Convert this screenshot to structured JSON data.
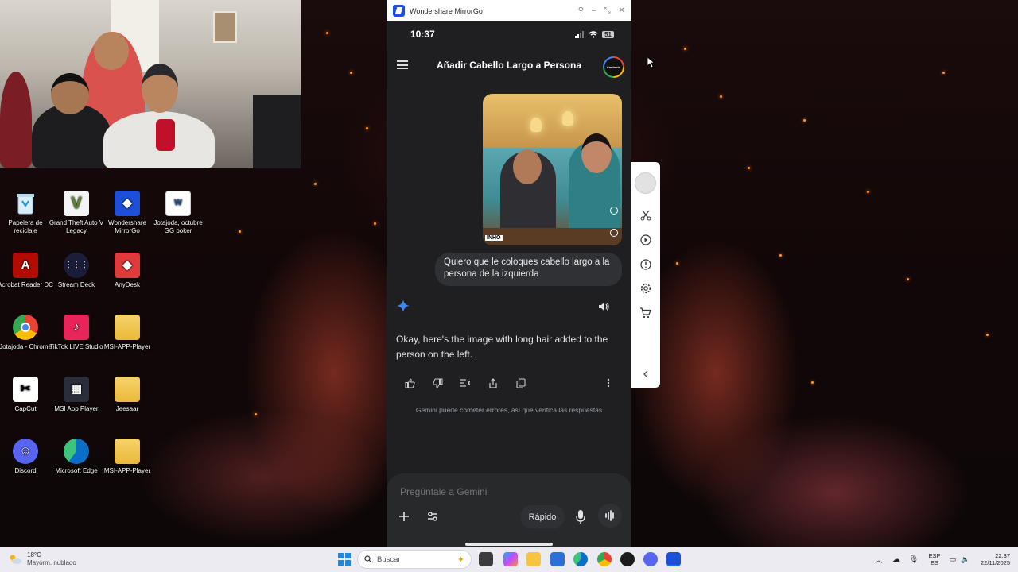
{
  "desktop": {
    "icons": [
      {
        "label": "Papelera de reciclaje",
        "icon": "recycle-bin-icon"
      },
      {
        "label": "Grand Theft Auto V Legacy",
        "icon": "gta-icon"
      },
      {
        "label": "Wondershare MirrorGo",
        "icon": "mirrorgo-icon"
      },
      {
        "label": "Jotajoda, octubre GG poker",
        "icon": "document-icon"
      },
      {
        "label": "Acrobat Reader DC",
        "icon": "acrobat-icon"
      },
      {
        "label": "Stream Deck",
        "icon": "stream-deck-icon"
      },
      {
        "label": "AnyDesk",
        "icon": "anydesk-icon"
      },
      {
        "label": "Jotajoda - Chrome",
        "icon": "chrome-icon"
      },
      {
        "label": "TikTok LIVE Studio",
        "icon": "tiktok-icon"
      },
      {
        "label": "MSI-APP-Player",
        "icon": "folder-icon"
      },
      {
        "label": "CapCut",
        "icon": "capcut-icon"
      },
      {
        "label": "MSI App Player",
        "icon": "msi-icon"
      },
      {
        "label": "Jeesaar",
        "icon": "folder-icon"
      },
      {
        "label": "Discord",
        "icon": "discord-icon"
      },
      {
        "label": "Microsoft Edge",
        "icon": "edge-icon"
      },
      {
        "label": "MSI-APP-Player",
        "icon": "folder-icon"
      }
    ]
  },
  "mirrorgo": {
    "window_title": "Wondershare MirrorGo",
    "phone": {
      "time": "10:37",
      "battery": "51",
      "chat_title": "Añadir Cabello Largo a Persona",
      "avatar_text": "Cantante",
      "image_tag": "INHO",
      "user_message": "Quiero que le coloques cabello largo a la persona de la izquierda",
      "response": "Okay, here's the image with long hair added to the person on the left.",
      "disclaimer": "Gemini puede cometer errores, así que verifica las respuestas",
      "input_placeholder": "Pregúntale a Gemini",
      "mode_label": "Rápido"
    }
  },
  "taskbar": {
    "weather_temp": "18°C",
    "weather_desc": "Mayorm. nublado",
    "search_placeholder": "Buscar",
    "lang_top": "ESP",
    "lang_bottom": "ES",
    "time": "22:37",
    "date": "22/11/2025"
  },
  "colors": {
    "phone_bg": "#1f1f21",
    "bubble_bg": "#303134",
    "gemini_blue": "#4285f4",
    "taskbar_bg": "#ecebf1"
  }
}
